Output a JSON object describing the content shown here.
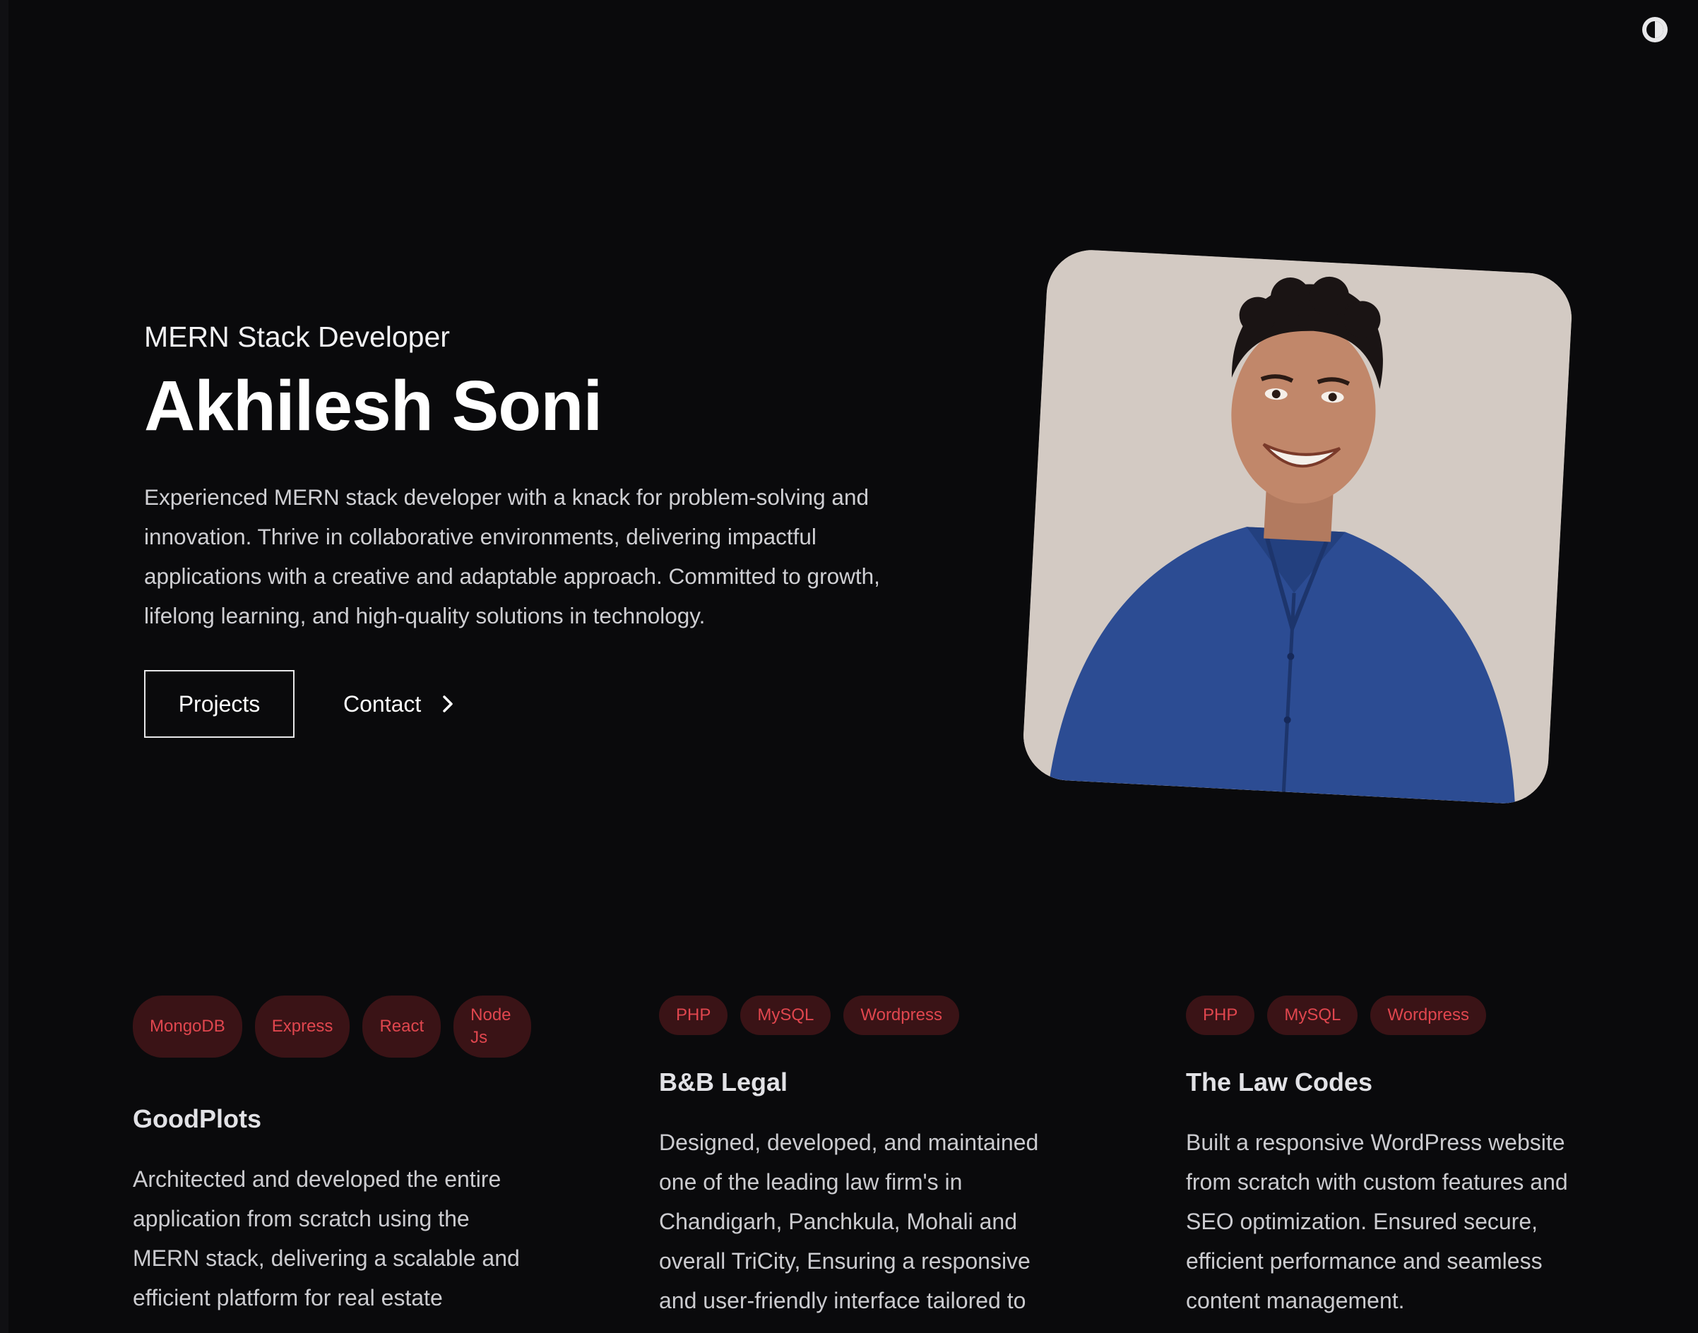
{
  "theme_toggle": {
    "icon": "contrast-icon"
  },
  "hero": {
    "subtitle": "MERN Stack Developer",
    "name": "Akhilesh Soni",
    "intro": "Experienced MERN stack developer with a knack for problem-solving and innovation. Thrive in collaborative environments, delivering impactful applications with a creative and adaptable approach. Committed to growth, lifelong learning, and high-quality solutions in technology.",
    "projects_button": "Projects",
    "contact_button": "Contact"
  },
  "projects": [
    {
      "tags": [
        "MongoDB",
        "Express",
        "React",
        "Node Js"
      ],
      "title": "GoodPlots",
      "description": "Architected and developed the entire application from scratch using the MERN stack, delivering a scalable and efficient platform for real estate"
    },
    {
      "tags": [
        "PHP",
        "MySQL",
        "Wordpress"
      ],
      "title": "B&B Legal",
      "description": "Designed, developed, and maintained one of the leading law firm's in Chandigarh, Panchkula, Mohali and overall TriCity, Ensuring a responsive and user-friendly interface tailored to"
    },
    {
      "tags": [
        "PHP",
        "MySQL",
        "Wordpress"
      ],
      "title": "The Law Codes",
      "description": "Built a responsive WordPress website from scratch with custom features and SEO optimization. Ensured secure, efficient performance and seamless content management."
    }
  ],
  "colors": {
    "background": "#0a0a0c",
    "tag_bg": "#3a1316",
    "tag_text": "#e0464e",
    "portrait_bg": "#d3cac3"
  }
}
